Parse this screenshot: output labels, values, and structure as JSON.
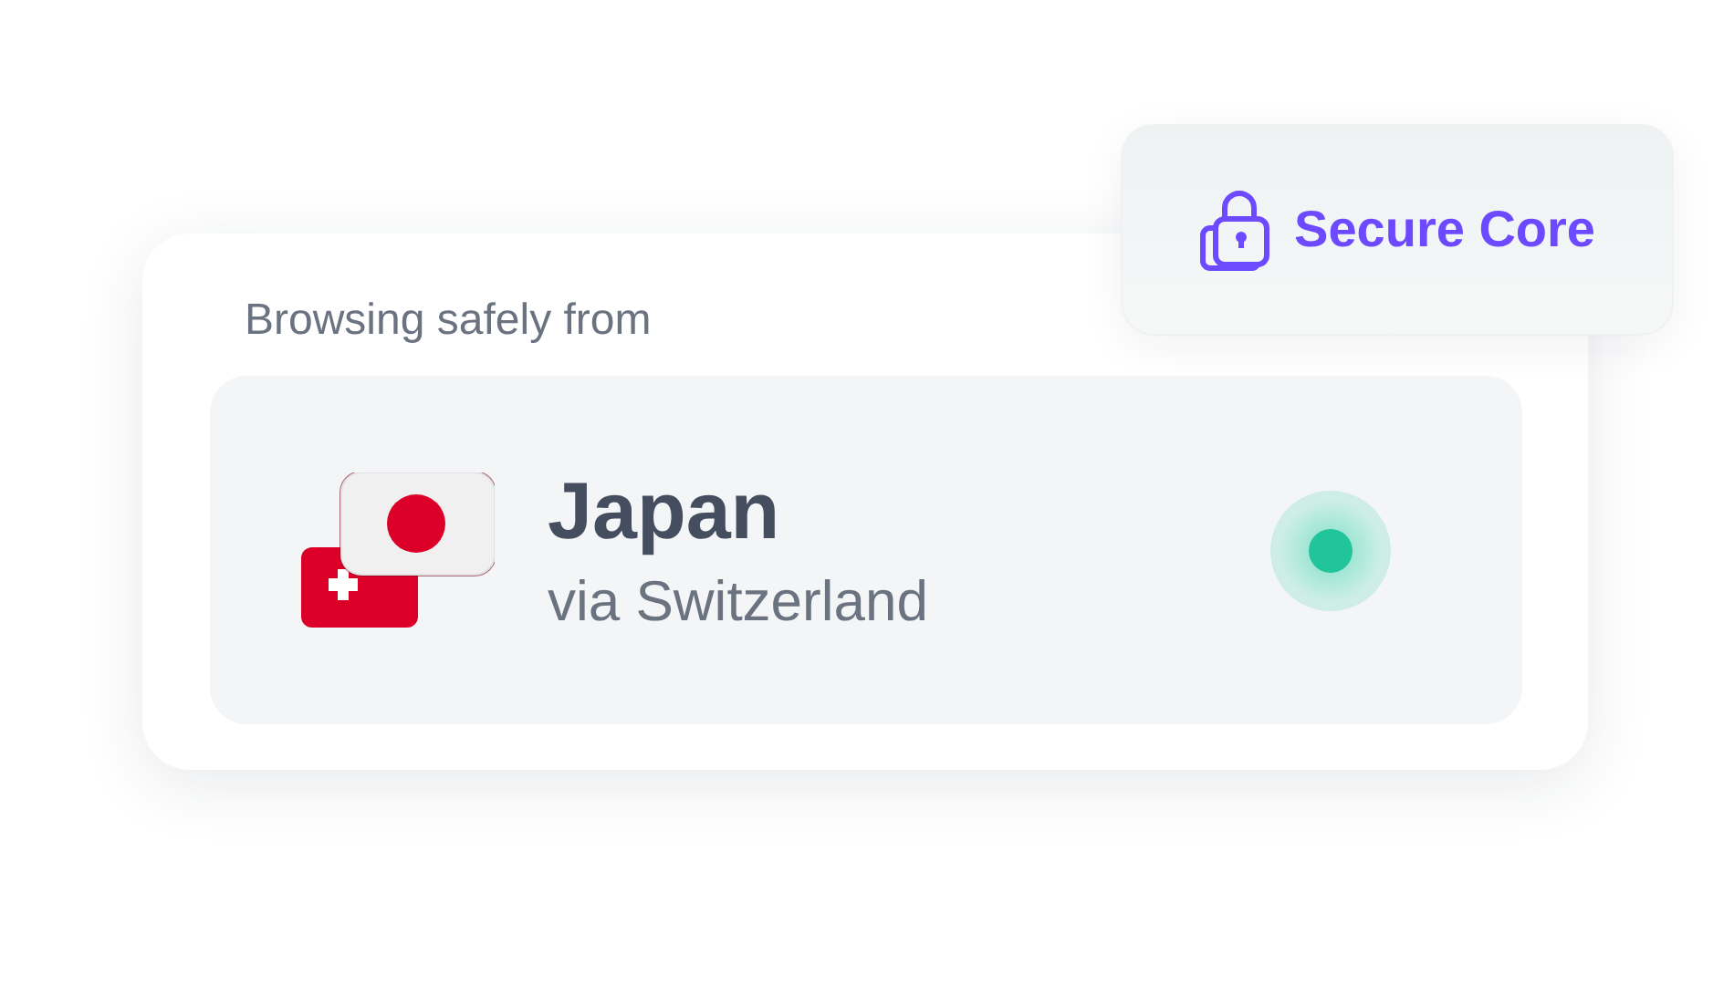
{
  "badge": {
    "label": "Secure Core"
  },
  "card": {
    "heading": "Browsing safely from",
    "location": {
      "country": "Japan",
      "via": "via Switzerland",
      "connected": true
    }
  }
}
